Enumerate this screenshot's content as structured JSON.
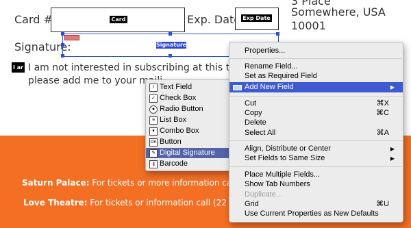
{
  "form": {
    "card_label": "Card #:",
    "card_field_tag": "Card",
    "exp_label": "Exp. Date",
    "exp_field_tag": "Exp Date",
    "signature_label": "Signature:",
    "signature_field_tag": "Signature",
    "checkbox_tag": "I ar",
    "optout_line1": "I am not interested in subscribing at this tim",
    "optout_line2": "please add me to your maili"
  },
  "address": {
    "line1": "3 Place",
    "line2": "Somewhere, USA",
    "line3": "10001"
  },
  "venues": [
    {
      "name": "Saturn Palace:",
      "text": "For tickets or more information ca"
    },
    {
      "name": "Love Theatre:",
      "text": "For tickets or information call (22"
    }
  ],
  "context_menu": {
    "items": [
      {
        "label": "Properties..."
      },
      {
        "label": "Rename Field..."
      },
      {
        "label": "Set as Required Field"
      },
      {
        "label": "Add New Field",
        "submenu": true,
        "highlighted": true
      },
      {
        "label": "Cut",
        "shortcut": "⌘X"
      },
      {
        "label": "Copy",
        "shortcut": "⌘C"
      },
      {
        "label": "Delete"
      },
      {
        "label": "Select All",
        "shortcut": "⌘A"
      },
      {
        "label": "Align, Distribute or Center",
        "submenu": true
      },
      {
        "label": "Set Fields to Same Size",
        "submenu": true
      },
      {
        "label": "Place Multiple Fields..."
      },
      {
        "label": "Show Tab Numbers"
      },
      {
        "label": "Duplicate...",
        "disabled": true
      },
      {
        "label": "Grid",
        "shortcut": "⌘U"
      },
      {
        "label": "Use Current Properties as New Defaults"
      }
    ],
    "submenu_arrow": "▶"
  },
  "submenu": {
    "items": [
      {
        "label": "Text Field",
        "icon": "text-field-icon",
        "glyph": "I"
      },
      {
        "label": "Check Box",
        "icon": "check-box-icon",
        "glyph": "✓"
      },
      {
        "label": "Radio Button",
        "icon": "radio-button-icon",
        "glyph": "●"
      },
      {
        "label": "List Box",
        "icon": "list-box-icon",
        "glyph": "≡"
      },
      {
        "label": "Combo Box",
        "icon": "combo-box-icon",
        "glyph": "▾"
      },
      {
        "label": "Button",
        "icon": "button-icon",
        "glyph": "OK"
      },
      {
        "label": "Digital Signature",
        "icon": "digital-signature-icon",
        "glyph": "✎",
        "highlighted": true
      },
      {
        "label": "Barcode",
        "icon": "barcode-icon",
        "glyph": "|||"
      }
    ]
  },
  "colors": {
    "orange_band": "#f36f24",
    "menu_highlight": "#3f5ad1",
    "selection_blue": "#2b50d8"
  }
}
